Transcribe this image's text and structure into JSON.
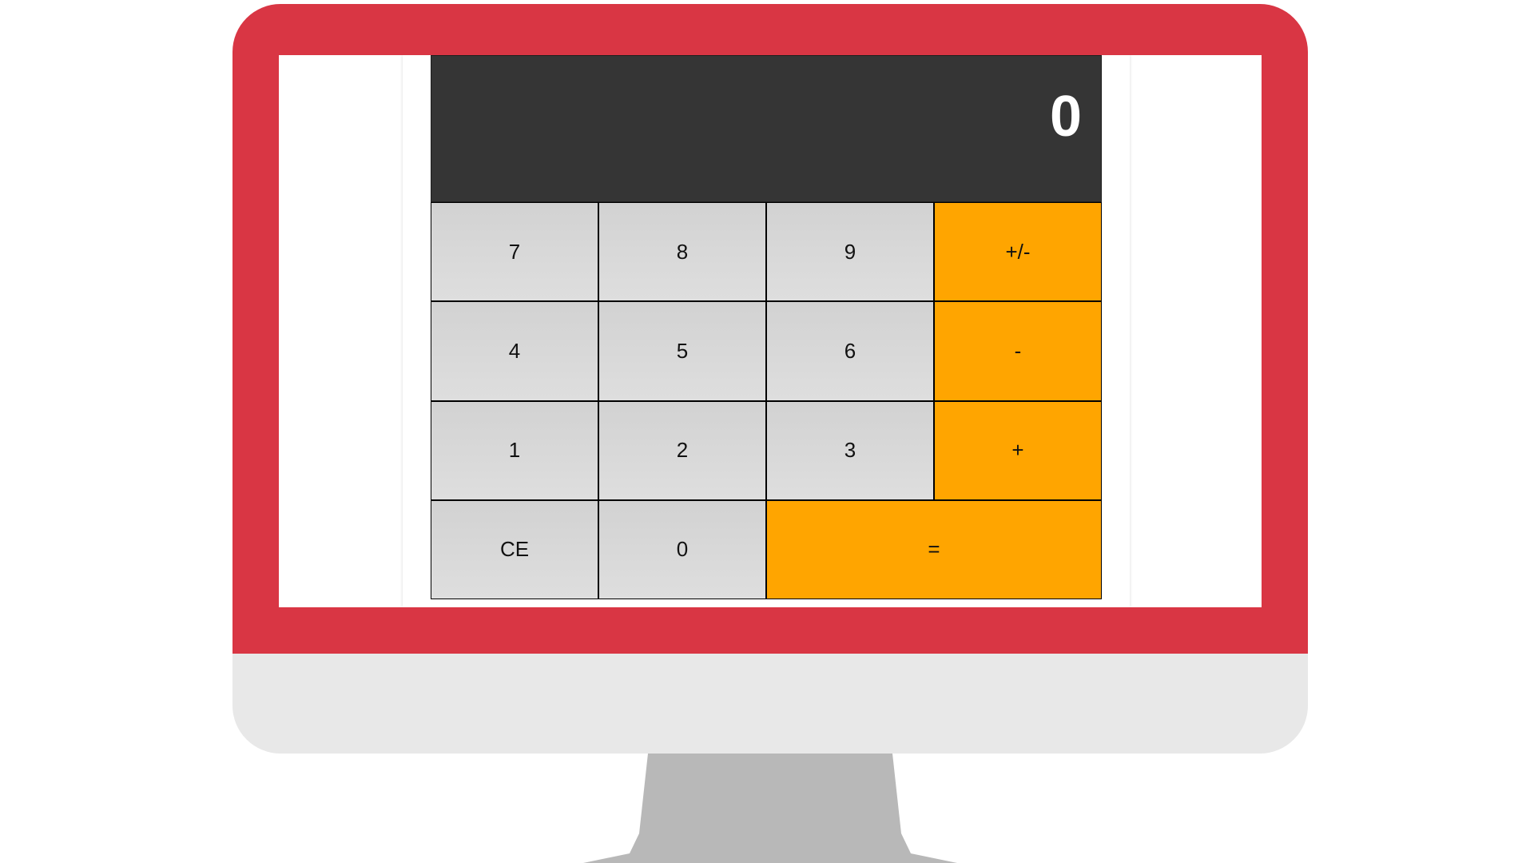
{
  "colors": {
    "bezel": "#d93644",
    "chin": "#e8e8e8",
    "stand": "#b8b8b8",
    "screen": "#ffffff",
    "display_bg": "#353535",
    "display_fg": "#ffffff",
    "number_key": "#d6d6d6",
    "operator_key": "#ffa500"
  },
  "calculator": {
    "display": "0",
    "keys": {
      "seven": "7",
      "eight": "8",
      "nine": "9",
      "plus_minus": "+/-",
      "four": "4",
      "five": "5",
      "six": "6",
      "minus": "-",
      "one": "1",
      "two": "2",
      "three": "3",
      "plus": "+",
      "clear": "CE",
      "zero": "0",
      "equals": "="
    }
  }
}
